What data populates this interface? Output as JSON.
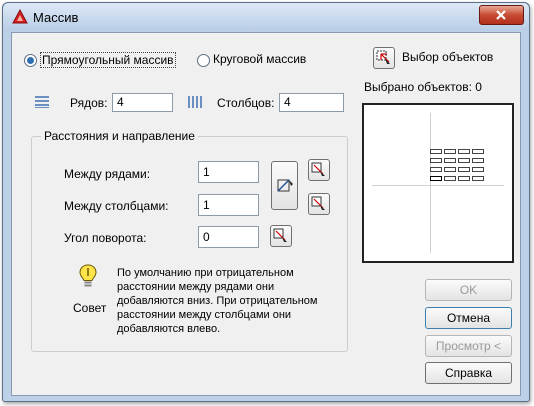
{
  "window": {
    "title": "Массив"
  },
  "array_type": {
    "rectangular_label": "Прямоугольный массив",
    "polar_label": "Круговой массив",
    "selected": "rectangular"
  },
  "rows": {
    "label": "Рядов:",
    "value": "4"
  },
  "columns": {
    "label": "Столбцов:",
    "value": "4"
  },
  "offset_group": {
    "legend": "Расстояния и направление",
    "row_offset": {
      "label": "Между рядами:",
      "value": "1"
    },
    "column_offset": {
      "label": "Между столбцами:",
      "value": "1"
    },
    "angle": {
      "label": "Угол поворота:",
      "value": "0"
    }
  },
  "tip": {
    "label": "Совет",
    "text": "По умолчанию при отрицательном расстоянии между рядами они добавляются вниз. При отрицательном расстоянии между столбцами они добавляются влево."
  },
  "select_objects": {
    "label": "Выбор объектов",
    "count_text": "Выбрано объектов: 0"
  },
  "preview": {
    "rows": 4,
    "columns": 4
  },
  "buttons": {
    "ok": "OK",
    "cancel": "Отмена",
    "preview": "Просмотр <",
    "help": "Справка"
  },
  "colors": {
    "title_bar": "#c9d9ec",
    "close_button": "#c74a32",
    "accent": "#2f6fb0"
  }
}
